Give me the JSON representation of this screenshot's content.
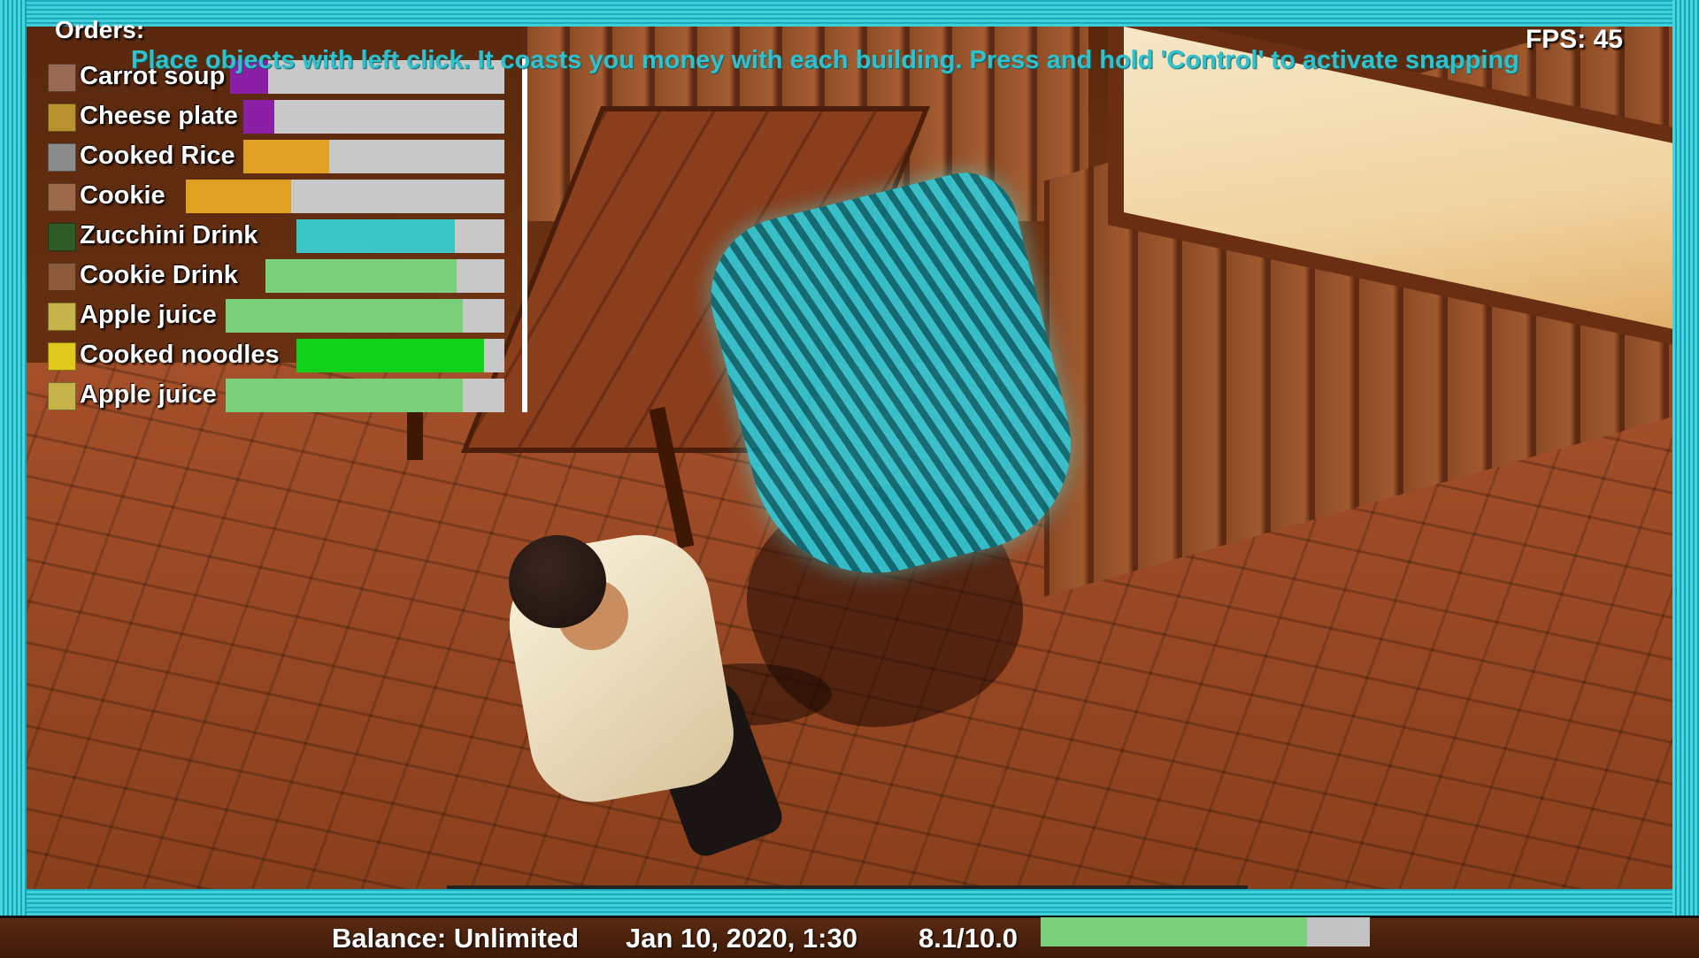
{
  "hud": {
    "orders_title": "Orders:",
    "hint": "Place objects with left click. It coasts you money with each building. Press and hold 'Control' to activate snapping",
    "fps_label": "FPS: 45"
  },
  "orders": [
    {
      "label": "Carrot soup",
      "icon_color": "#9a6a55",
      "progress": 0.14,
      "bar_color": "#8a1fa6"
    },
    {
      "label": "Cheese plate",
      "icon_color": "#b8922e",
      "progress": 0.12,
      "bar_color": "#8a1fa6"
    },
    {
      "label": "Cooked Rice",
      "icon_color": "#8c8c8c",
      "progress": 0.33,
      "bar_color": "#e0a021"
    },
    {
      "label": "Cookie",
      "icon_color": "#9a6a4a",
      "progress": 0.33,
      "bar_color": "#e0a021"
    },
    {
      "label": "Zucchini Drink",
      "icon_color": "#2e5a25",
      "progress": 0.76,
      "bar_color": "#3cc5c5"
    },
    {
      "label": "Cookie Drink",
      "icon_color": "#8a5a3a",
      "progress": 0.8,
      "bar_color": "#7bd07b"
    },
    {
      "label": "Apple juice",
      "icon_color": "#c6b44a",
      "progress": 0.85,
      "bar_color": "#7bd07b"
    },
    {
      "label": "Cooked noodles",
      "icon_color": "#e0c81c",
      "progress": 0.9,
      "bar_color": "#11d11a"
    },
    {
      "label": "Apple juice",
      "icon_color": "#c6b44a",
      "progress": 0.85,
      "bar_color": "#7bd07b"
    }
  ],
  "status": {
    "balance": "Balance: Unlimited",
    "datetime": "Jan 10, 2020, 1:30",
    "rating_text": "8.1/10.0",
    "rating_value": 0.81
  },
  "colors": {
    "frame": "#3fd0dc",
    "hint": "#31c1cc",
    "ghost_object": "#33c9d6"
  },
  "icons": [
    "orders-food-icons",
    "placement-ghost-chair"
  ]
}
